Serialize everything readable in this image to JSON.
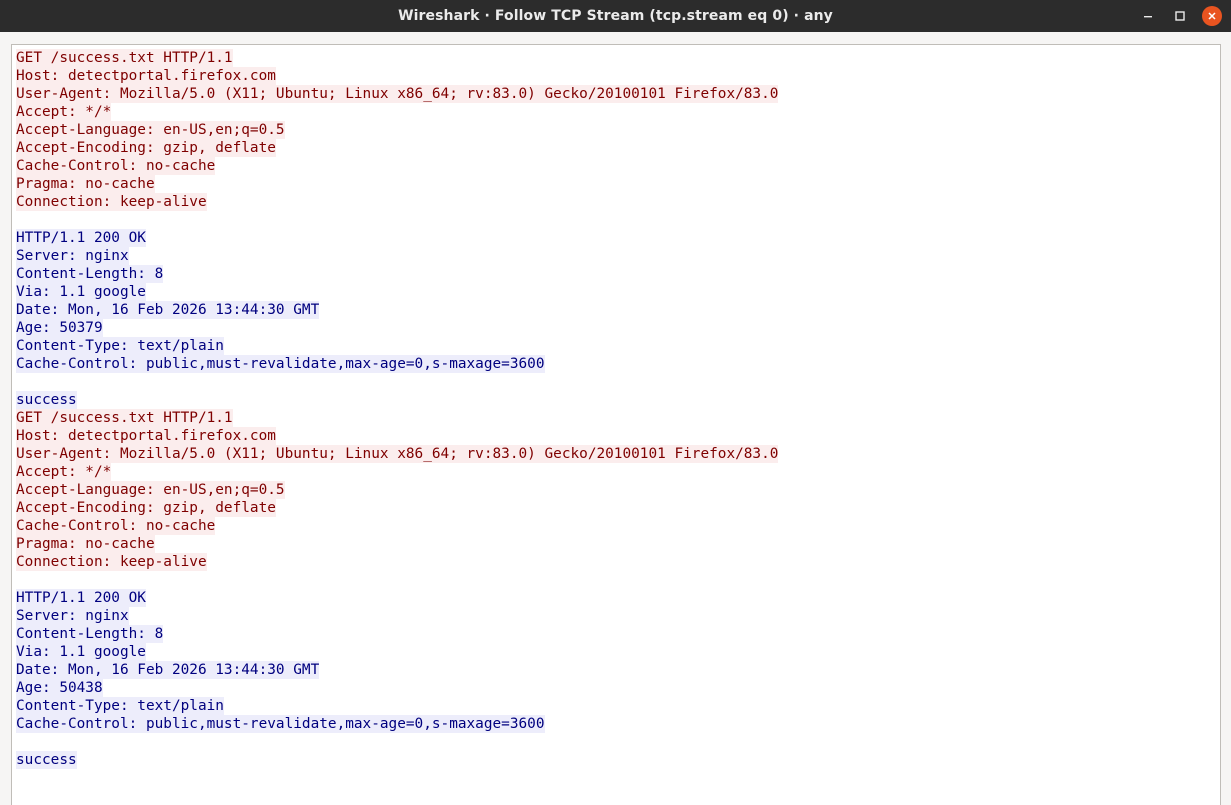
{
  "window": {
    "title": "Wireshark · Follow TCP Stream (tcp.stream eq 0) · any"
  },
  "colors": {
    "client_text": "#7f0000",
    "client_bg": "#fbeded",
    "server_text": "#00007f",
    "server_bg": "#ededfb",
    "titlebar_bg": "#2c2c2c",
    "close_button": "#e95420"
  },
  "icons": {
    "minimize": "minimize-icon",
    "maximize": "maximize-icon",
    "close": "close-icon"
  },
  "stream": {
    "lines": [
      {
        "dir": "client",
        "text": "GET /success.txt HTTP/1.1"
      },
      {
        "dir": "client",
        "text": "Host: detectportal.firefox.com"
      },
      {
        "dir": "client",
        "text": "User-Agent: Mozilla/5.0 (X11; Ubuntu; Linux x86_64; rv:83.0) Gecko/20100101 Firefox/83.0"
      },
      {
        "dir": "client",
        "text": "Accept: */*"
      },
      {
        "dir": "client",
        "text": "Accept-Language: en-US,en;q=0.5"
      },
      {
        "dir": "client",
        "text": "Accept-Encoding: gzip, deflate"
      },
      {
        "dir": "client",
        "text": "Cache-Control: no-cache"
      },
      {
        "dir": "client",
        "text": "Pragma: no-cache"
      },
      {
        "dir": "client",
        "text": "Connection: keep-alive"
      },
      {
        "dir": "client",
        "text": ""
      },
      {
        "dir": "server",
        "text": "HTTP/1.1 200 OK"
      },
      {
        "dir": "server",
        "text": "Server: nginx"
      },
      {
        "dir": "server",
        "text": "Content-Length: 8"
      },
      {
        "dir": "server",
        "text": "Via: 1.1 google"
      },
      {
        "dir": "server",
        "text": "Date: Mon, 16 Feb 2026 13:44:30 GMT"
      },
      {
        "dir": "server",
        "text": "Age: 50379"
      },
      {
        "dir": "server",
        "text": "Content-Type: text/plain"
      },
      {
        "dir": "server",
        "text": "Cache-Control: public,must-revalidate,max-age=0,s-maxage=3600"
      },
      {
        "dir": "server",
        "text": ""
      },
      {
        "dir": "server",
        "text": "success"
      },
      {
        "dir": "client",
        "text": "GET /success.txt HTTP/1.1"
      },
      {
        "dir": "client",
        "text": "Host: detectportal.firefox.com"
      },
      {
        "dir": "client",
        "text": "User-Agent: Mozilla/5.0 (X11; Ubuntu; Linux x86_64; rv:83.0) Gecko/20100101 Firefox/83.0"
      },
      {
        "dir": "client",
        "text": "Accept: */*"
      },
      {
        "dir": "client",
        "text": "Accept-Language: en-US,en;q=0.5"
      },
      {
        "dir": "client",
        "text": "Accept-Encoding: gzip, deflate"
      },
      {
        "dir": "client",
        "text": "Cache-Control: no-cache"
      },
      {
        "dir": "client",
        "text": "Pragma: no-cache"
      },
      {
        "dir": "client",
        "text": "Connection: keep-alive"
      },
      {
        "dir": "client",
        "text": ""
      },
      {
        "dir": "server",
        "text": "HTTP/1.1 200 OK"
      },
      {
        "dir": "server",
        "text": "Server: nginx"
      },
      {
        "dir": "server",
        "text": "Content-Length: 8"
      },
      {
        "dir": "server",
        "text": "Via: 1.1 google"
      },
      {
        "dir": "server",
        "text": "Date: Mon, 16 Feb 2026 13:44:30 GMT"
      },
      {
        "dir": "server",
        "text": "Age: 50438"
      },
      {
        "dir": "server",
        "text": "Content-Type: text/plain"
      },
      {
        "dir": "server",
        "text": "Cache-Control: public,must-revalidate,max-age=0,s-maxage=3600"
      },
      {
        "dir": "server",
        "text": ""
      },
      {
        "dir": "server",
        "text": "success"
      }
    ]
  }
}
